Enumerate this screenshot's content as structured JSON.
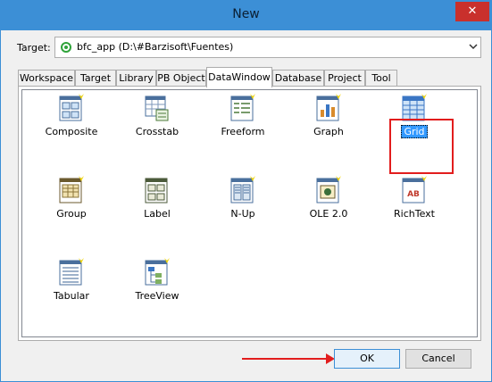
{
  "window": {
    "title": "New",
    "close_glyph": "✕"
  },
  "target": {
    "label": "Target:",
    "value": "bfc_app (D:\\#Barzisoft\\Fuentes)",
    "icon": "target-app-icon"
  },
  "tabs": [
    {
      "label": "Workspace"
    },
    {
      "label": "Target"
    },
    {
      "label": "Library"
    },
    {
      "label": "PB Object"
    },
    {
      "label": "DataWindow",
      "active": true
    },
    {
      "label": "Database"
    },
    {
      "label": "Project"
    },
    {
      "label": "Tool"
    }
  ],
  "items": [
    {
      "label": "Composite",
      "icon": "composite-icon"
    },
    {
      "label": "Crosstab",
      "icon": "crosstab-icon"
    },
    {
      "label": "Freeform",
      "icon": "freeform-icon"
    },
    {
      "label": "Graph",
      "icon": "graph-icon"
    },
    {
      "label": "Grid",
      "icon": "grid-icon",
      "selected": true
    },
    {
      "label": "Group",
      "icon": "group-icon"
    },
    {
      "label": "Label",
      "icon": "label-icon"
    },
    {
      "label": "N-Up",
      "icon": "nup-icon"
    },
    {
      "label": "OLE 2.0",
      "icon": "ole-icon"
    },
    {
      "label": "RichText",
      "icon": "richtext-icon",
      "icon_text": "AB"
    },
    {
      "label": "Tabular",
      "icon": "tabular-icon"
    },
    {
      "label": "TreeView",
      "icon": "treeview-icon"
    }
  ],
  "buttons": {
    "ok": "OK",
    "cancel": "Cancel"
  },
  "colors": {
    "accent": "#3c8fd6",
    "close": "#c9302c",
    "annotation": "#e21d1d",
    "selection": "#3399ff"
  }
}
